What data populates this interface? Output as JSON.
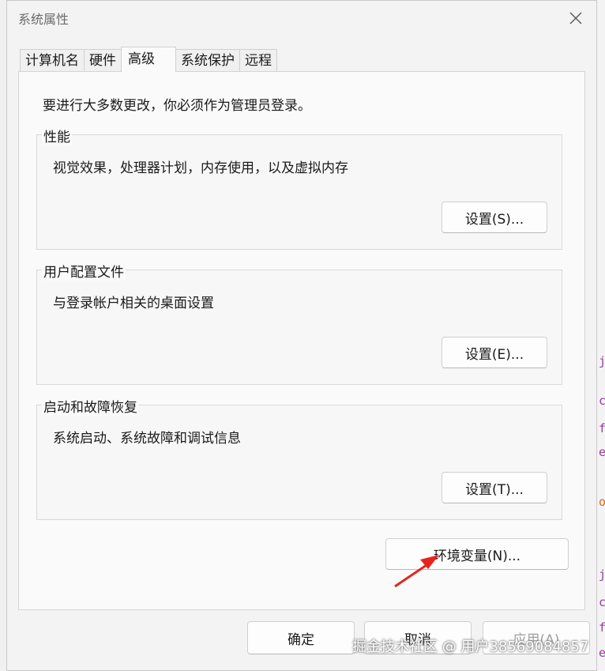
{
  "window": {
    "title": "系统属性"
  },
  "tabs": [
    {
      "label": "计算机名"
    },
    {
      "label": "硬件"
    },
    {
      "label": "高级"
    },
    {
      "label": "系统保护"
    },
    {
      "label": "远程"
    }
  ],
  "admin_note": "要进行大多数更改，你必须作为管理员登录。",
  "performance": {
    "title": "性能",
    "desc": "视觉效果，处理器计划，内存使用，以及虚拟内存",
    "button": "设置(S)..."
  },
  "profiles": {
    "title": "用户配置文件",
    "desc": "与登录帐户相关的桌面设置",
    "button": "设置(E)..."
  },
  "startup": {
    "title": "启动和故障恢复",
    "desc": "系统启动、系统故障和调试信息",
    "button": "设置(T)..."
  },
  "env_button": "环境变量(N)...",
  "footer": {
    "ok": "确定",
    "cancel": "取消",
    "apply": "应用(A)"
  },
  "watermark": "掘金技术社区 @ 用户38569084857",
  "background_app": {
    "chars": [
      "j",
      "c",
      "f",
      "e",
      "o",
      "j",
      "c",
      "f",
      "e"
    ]
  },
  "colors": {
    "arrow": "#e8231e",
    "dialog_bg": "#f3f3f3",
    "disabled_text": "#a0a0a0"
  }
}
